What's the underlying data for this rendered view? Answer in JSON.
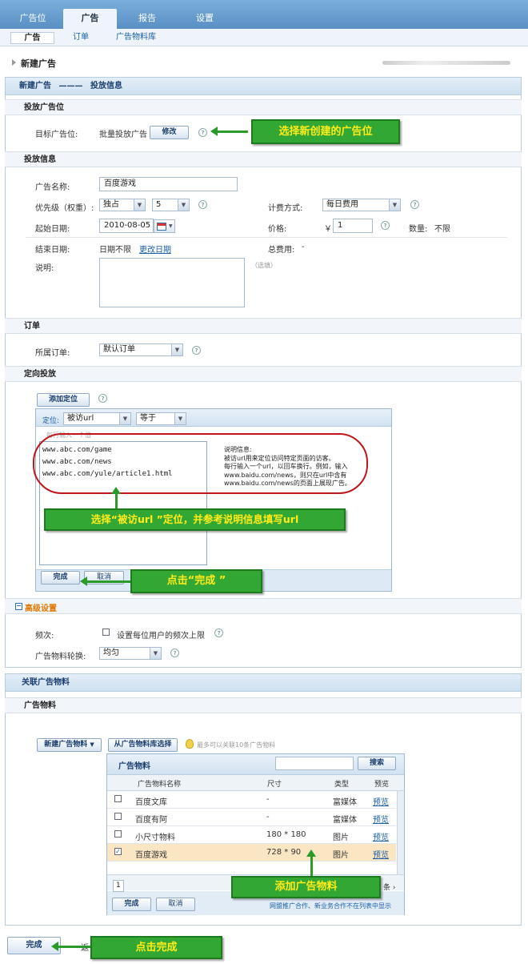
{
  "tabs": [
    "广告位",
    "广告",
    "报告",
    "设置"
  ],
  "subtabs": [
    "广告",
    "订单",
    "广告物料库"
  ],
  "page_title": "新建广告",
  "crumb": {
    "step": "新建广告",
    "sep": "———",
    "current": "投放信息"
  },
  "slot": {
    "section": "投放广告位",
    "label": "目标广告位:",
    "value": "批量投放广告",
    "btn": "修改",
    "q": "?",
    "callout": "选择新创建的广告位"
  },
  "info": {
    "section": "投放信息",
    "name_label": "广告名称:",
    "name_value": "百度游戏",
    "priority_label": "优先级（权重）:",
    "priority_value": "独占",
    "weight_value": "5",
    "billing_label": "计费方式:",
    "billing_value": "每日费用",
    "start_label": "起始日期:",
    "start_value": "2010-08-05",
    "price_label": "价格:",
    "price_currency": "￥",
    "price_value": "1",
    "qty_label": "数量:",
    "qty_value": "不限",
    "end_label": "结束日期:",
    "end_value": "日期不限",
    "end_link": "更改日期",
    "total_label": "总费用:",
    "total_value": "-",
    "desc_label": "说明:",
    "desc_hint": "（选填）"
  },
  "order": {
    "section": "订单",
    "label": "所属订单:",
    "value": "默认订单"
  },
  "targeting": {
    "section": "定向投放",
    "add_btn": "添加定位",
    "dim_label": "定位:",
    "dim_value": "被访url",
    "op_value": "等于",
    "hint": "每行输入一个值",
    "urls": [
      "www.abc.com/game",
      "www.abc.com/news",
      "www.abc.com/yule/article1.html"
    ],
    "note_title": "说明信息:",
    "note_lines": [
      "被访url用来定位访问特定页面的访客。",
      "每行输入一个url，以回车换行。例如，输入",
      "www.baidu.com/news，则只在url中含有",
      "www.baidu.com/news的页面上展现广告。"
    ],
    "done": "完成",
    "cancel": "取消",
    "callout": "选择“被访url ”定位，并参考说明信息填写url",
    "callout2": "点击“完成 ”"
  },
  "advanced": {
    "section": "高级设置",
    "freq_label": "频次:",
    "freq_check": "设置每位用户的频次上限",
    "rotate_label": "广告物料轮换:",
    "rotate_value": "均匀"
  },
  "creative": {
    "panel": "关联广告物料",
    "section": "广告物料",
    "new_btn": "新建广告物料",
    "lib_btn": "从广告物料库选择",
    "tip": "最多可以关联10条广告物料",
    "grid_title": "广告物料",
    "search_btn": "搜索",
    "cols": [
      "广告物料名称",
      "尺寸",
      "类型",
      "预览"
    ],
    "rows": [
      {
        "name": "百度文库",
        "size": "-",
        "type": "富媒体",
        "preview": "预览",
        "checked": false
      },
      {
        "name": "百度有阿",
        "size": "-",
        "type": "富媒体",
        "preview": "预览",
        "checked": false
      },
      {
        "name": "小尺寸物料",
        "size": "180 * 180",
        "type": "图片",
        "preview": "预览",
        "checked": false
      },
      {
        "name": "百度游戏",
        "size": "728 * 90",
        "type": "图片",
        "preview": "预览",
        "checked": true
      }
    ],
    "page_num": "1",
    "page_tail": "条 ›",
    "done": "完成",
    "cancel": "取消",
    "footnote": "网盟推广合作、新业务合作不在列表中显示",
    "callout": "添加广告物料"
  },
  "footer": {
    "done": "完成",
    "back": "返",
    "callout": "点击完成"
  },
  "colors": {
    "callout_bg": "#33a733",
    "callout_text": "#ffec1a",
    "red_ring": "#c0151b",
    "selected_row": "#fbe6c3"
  }
}
